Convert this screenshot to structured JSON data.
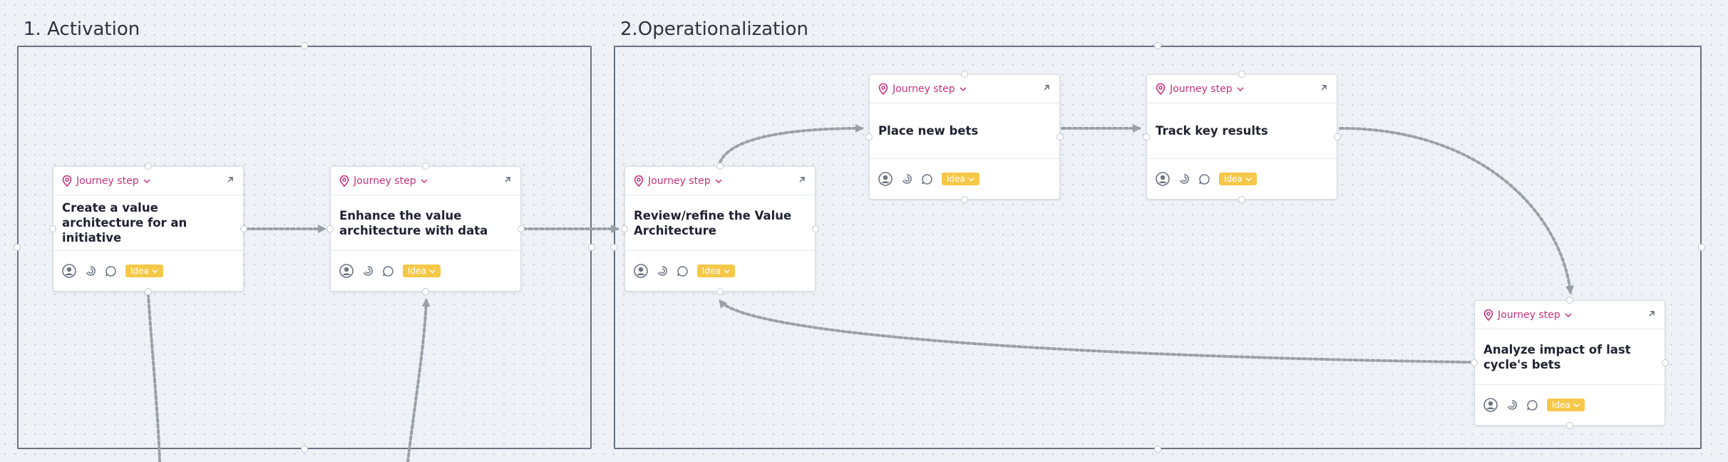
{
  "sections": [
    {
      "title": "1. Activation"
    },
    {
      "title": "2.Operationalization"
    }
  ],
  "cards": [
    {
      "step_label": "Journey step",
      "title": "Create a value architecture for an initiative",
      "badge": "Idea"
    },
    {
      "step_label": "Journey step",
      "title": "Enhance the value architecture with data",
      "badge": "Idea"
    },
    {
      "step_label": "Journey step",
      "title": "Review/refine the Value Architecture",
      "badge": "Idea"
    },
    {
      "step_label": "Journey step",
      "title": "Place new bets",
      "badge": "Idea"
    },
    {
      "step_label": "Journey step",
      "title": "Track key results",
      "badge": "Idea"
    },
    {
      "step_label": "Journey step",
      "title": "Analyze impact of last cycle's bets",
      "badge": "Idea"
    }
  ],
  "colors": {
    "accent": "#c8307a",
    "badge": "#f5c84a",
    "connector": "#9aa0a8",
    "frame": "#6b7280"
  },
  "icons": [
    "location-pin-icon",
    "chevron-down-icon",
    "expand-arrow-icon",
    "user-avatar-icon",
    "effort-icon",
    "comment-icon"
  ]
}
